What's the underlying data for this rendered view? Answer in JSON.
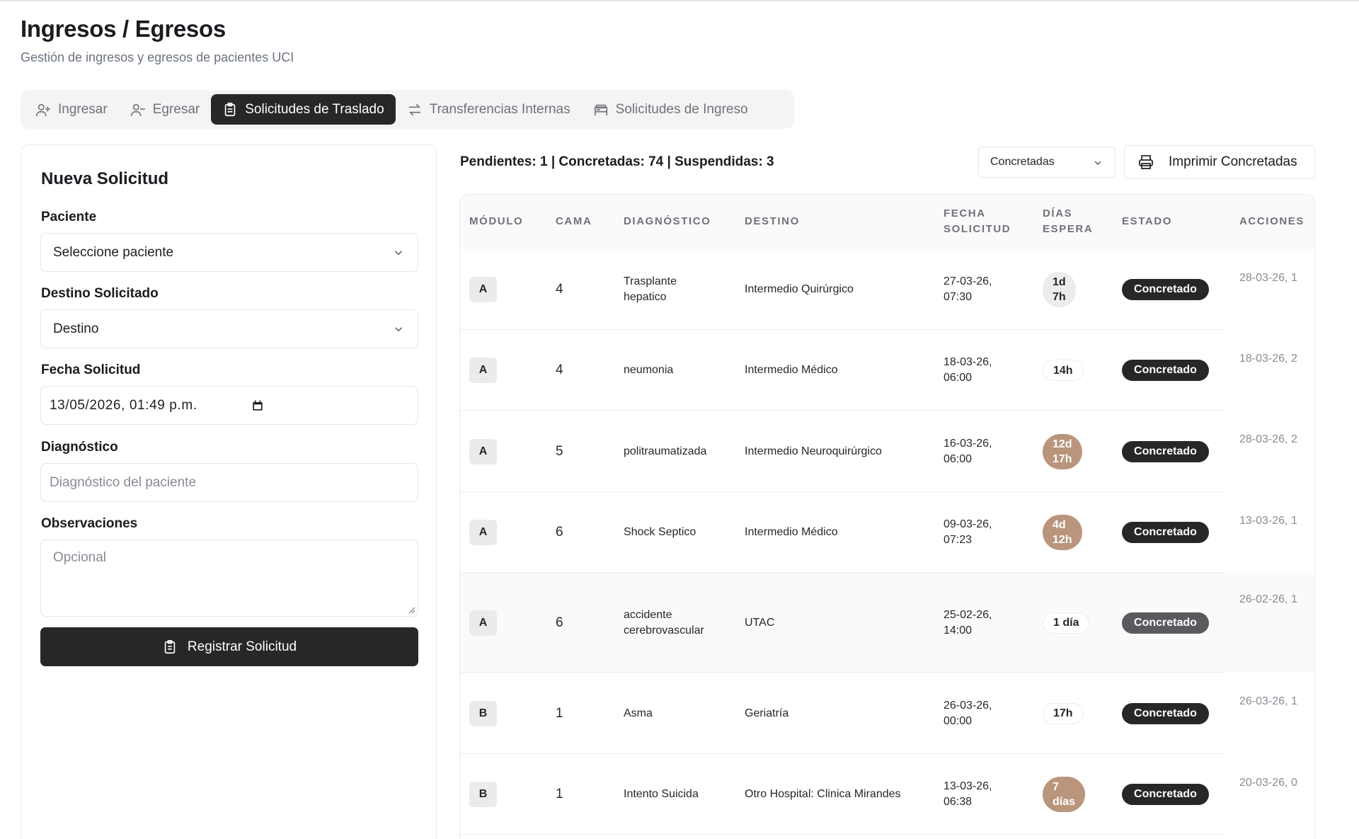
{
  "header": {
    "title": "Ingresos / Egresos",
    "subtitle": "Gestión de ingresos y egresos de pacientes UCI"
  },
  "tabs": [
    {
      "label": "Ingresar",
      "icon": "user-plus-icon"
    },
    {
      "label": "Egresar",
      "icon": "user-minus-icon"
    },
    {
      "label": "Solicitudes de Traslado",
      "icon": "clipboard-icon",
      "active": true
    },
    {
      "label": "Transferencias Internas",
      "icon": "arrows-left-right-icon"
    },
    {
      "label": "Solicitudes de Ingreso",
      "icon": "bed-icon"
    }
  ],
  "form": {
    "title": "Nueva Solicitud",
    "paciente_label": "Paciente",
    "paciente_value": "Seleccione paciente",
    "destino_label": "Destino Solicitado",
    "destino_value": "Destino",
    "fecha_label": "Fecha Solicitud",
    "fecha_value": "13/05/2026, 01:49 p.m.",
    "diagnostico_label": "Diagnóstico",
    "diagnostico_placeholder": "Diagnóstico del paciente",
    "observaciones_label": "Observaciones",
    "observaciones_placeholder": "Opcional",
    "submit_label": "Registrar Solicitud"
  },
  "summary": "Pendientes: 1 | Concretadas: 74 | Suspendidas: 3",
  "filter_value": "Concretadas",
  "print_label": "Imprimir Concretadas",
  "table": {
    "headers": {
      "modulo": "MÓDULO",
      "cama": "CAMA",
      "diagnostico": "DIAGNÓSTICO",
      "destino": "DESTINO",
      "fecha": [
        "FECHA",
        "SOLICITUD"
      ],
      "dias": [
        "DÍAS",
        "ESPERA"
      ],
      "estado": "ESTADO",
      "acciones": "ACCIONES"
    },
    "rows": [
      {
        "modulo": "A",
        "cama": "4",
        "diagnostico": [
          "Trasplante",
          "hepatico"
        ],
        "destino": "Intermedio Quirúrgico",
        "fecha": [
          "27-03-26,",
          "07:30"
        ],
        "espera": [
          "1d",
          "7h"
        ],
        "espera_style": "gray",
        "estado": "Concretado",
        "accion": "28-03-26, 1"
      },
      {
        "modulo": "A",
        "cama": "4",
        "diagnostico": [
          "neumonia"
        ],
        "destino": "Intermedio Médico",
        "fecha": [
          "18-03-26,",
          "06:00"
        ],
        "espera": [
          "14h"
        ],
        "espera_style": "plain",
        "estado": "Concretado",
        "accion": "18-03-26, 2"
      },
      {
        "modulo": "A",
        "cama": "5",
        "diagnostico": [
          "politraumatizada"
        ],
        "destino": "Intermedio Neuroquirúrgico",
        "fecha": [
          "16-03-26,",
          "06:00"
        ],
        "espera": [
          "12d",
          "17h"
        ],
        "espera_style": "brown",
        "estado": "Concretado",
        "accion": "28-03-26, 2"
      },
      {
        "modulo": "A",
        "cama": "6",
        "diagnostico": [
          "Shock Septico"
        ],
        "destino": "Intermedio Médico",
        "fecha": [
          "09-03-26,",
          "07:23"
        ],
        "espera": [
          "4d",
          "12h"
        ],
        "espera_style": "brown",
        "estado": "Concretado",
        "accion": "13-03-26, 1"
      },
      {
        "modulo": "A",
        "cama": "6",
        "diagnostico": [
          "accidente",
          "cerebrovascular"
        ],
        "destino": "UTAC",
        "fecha": [
          "25-02-26,",
          "14:00"
        ],
        "espera": [
          "1 día"
        ],
        "espera_style": "plain",
        "estado": "Concretado",
        "accion": "26-02-26, 1"
      },
      {
        "modulo": "B",
        "cama": "1",
        "diagnostico": [
          "Asma"
        ],
        "destino": "Geriatría",
        "fecha": [
          "26-03-26,",
          "00:00"
        ],
        "espera": [
          "17h"
        ],
        "espera_style": "plain",
        "estado": "Concretado",
        "accion": "26-03-26, 1"
      },
      {
        "modulo": "B",
        "cama": "1",
        "diagnostico": [
          "Intento Suicida"
        ],
        "destino": "Otro Hospital: Clinica Mirandes",
        "fecha": [
          "13-03-26,",
          "06:38"
        ],
        "espera": [
          "7",
          "días"
        ],
        "espera_style": "brown",
        "estado": "Concretado",
        "accion": "20-03-26, 0"
      }
    ]
  },
  "colors": {
    "accent_dark": "#27272a",
    "wait_brown": "#b9957c",
    "wait_gray": "#ececef"
  }
}
